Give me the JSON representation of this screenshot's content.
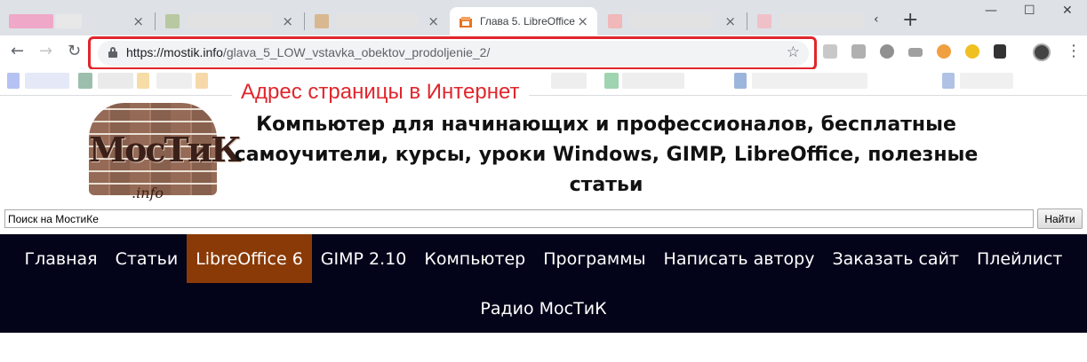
{
  "browser": {
    "active_tab": {
      "title": "Глава 5. LibreOffice",
      "close": "×"
    },
    "tab_close": "×",
    "new_tab": "+",
    "window": {
      "minimize": "—",
      "maximize": "☐",
      "close": "✕"
    },
    "url": {
      "host": "https://mostik.info",
      "path": "/glava_5_LOW_vstavka_obektov_prodoljenie_2/"
    },
    "icons": {
      "back": "←",
      "forward": "→",
      "reload": "↻",
      "star": "☆",
      "menu": "⋮",
      "tab_search": "‹"
    }
  },
  "annotation": {
    "text": "Адрес страницы в Интернет",
    "color": "#e0262c"
  },
  "header": {
    "logo_text": "МосТиК",
    "logo_sub": ".info",
    "site_title": "Компьютер для начинающих и профессионалов, бесплатные самоучители, курсы, уроки Windows, GIMP, LibreOffice, полезные статьи"
  },
  "search": {
    "value": "Поиск на МостиКе",
    "button": "Найти"
  },
  "nav": {
    "row1": [
      "Главная",
      "Статьи",
      "LibreOffice 6",
      "GIMP 2.10",
      "Компьютер",
      "Программы",
      "Написать автору",
      "Заказать сайт",
      "Плейлист"
    ],
    "row2": [
      "Радио МосТиК"
    ],
    "active": "LibreOffice 6",
    "colors": {
      "background": "#03031a",
      "active": "#8a3a06",
      "text": "#ffffff"
    }
  }
}
